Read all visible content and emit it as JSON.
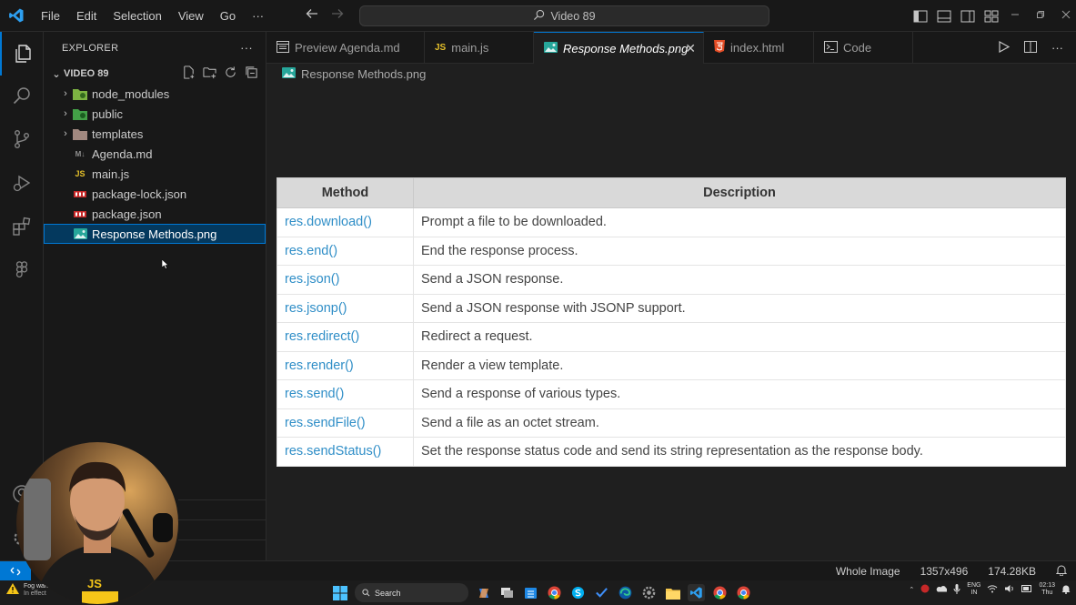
{
  "menu": [
    "File",
    "Edit",
    "Selection",
    "View",
    "Go",
    "···"
  ],
  "command_center": "Video 89",
  "explorer": {
    "title": "EXPLORER",
    "more": "···",
    "folder": "VIDEO 89",
    "items": [
      {
        "label": "node_modules",
        "type": "folder",
        "icon": "node-folder-icon",
        "color": "#8bc34a"
      },
      {
        "label": "public",
        "type": "folder",
        "icon": "public-folder-icon",
        "color": "#43a047"
      },
      {
        "label": "templates",
        "type": "folder",
        "icon": "templates-folder-icon",
        "color": "#a1887f"
      },
      {
        "label": "Agenda.md",
        "type": "file",
        "icon": "markdown-icon",
        "badge": "M↓"
      },
      {
        "label": "main.js",
        "type": "file",
        "icon": "js-icon",
        "badge": "JS"
      },
      {
        "label": "package-lock.json",
        "type": "file",
        "icon": "npm-icon",
        "badge": "npm"
      },
      {
        "label": "package.json",
        "type": "file",
        "icon": "npm-icon",
        "badge": "npm"
      },
      {
        "label": "Response Methods.png",
        "type": "file",
        "icon": "image-icon",
        "selected": true
      }
    ]
  },
  "tabs": [
    {
      "label": "Preview Agenda.md",
      "icon": "preview-icon",
      "width": 174
    },
    {
      "label": "main.js",
      "icon": "js-icon",
      "badge": "JS",
      "width": 120
    },
    {
      "label": "Response Methods.png",
      "icon": "image-icon",
      "active": true,
      "close": "✕",
      "width": 187
    },
    {
      "label": "index.html",
      "icon": "html-icon",
      "width": 121
    },
    {
      "label": "Code",
      "icon": "terminal-icon",
      "width": 109
    }
  ],
  "breadcrumb": "Response Methods.png",
  "image_table": {
    "headers": [
      "Method",
      "Description"
    ],
    "rows": [
      {
        "method": "res.download()",
        "description": "Prompt a file to be downloaded."
      },
      {
        "method": "res.end()",
        "description": "End the response process."
      },
      {
        "method": "res.json()",
        "description": "Send a JSON response."
      },
      {
        "method": "res.jsonp()",
        "description": "Send a JSON response with JSONP support."
      },
      {
        "method": "res.redirect()",
        "description": "Redirect a request."
      },
      {
        "method": "res.render()",
        "description": "Render a view template."
      },
      {
        "method": "res.send()",
        "description": "Send a response of various types."
      },
      {
        "method": "res.sendFile()",
        "description": "Send a file as an octet stream."
      },
      {
        "method": "res.sendStatus()",
        "description": "Set the response status code and send its string representation as the response body."
      }
    ]
  },
  "status": {
    "zoom": "Whole Image",
    "dimensions": "1357x496",
    "size": "174.28KB"
  },
  "taskbar": {
    "weather_title": "Fog warn...",
    "weather_sub": "In effect",
    "search": "Search",
    "lang": "ENG",
    "region": "IN",
    "time": "02:13",
    "day": "Thu"
  },
  "colors": {
    "accent": "#0078d4",
    "method_link": "#2f8ec7"
  }
}
